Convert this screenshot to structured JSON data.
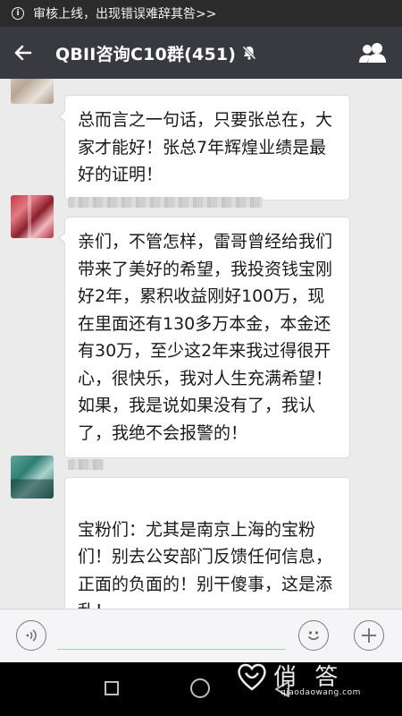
{
  "notice": {
    "text": "审核上线，出现错误难辞其咎>>"
  },
  "header": {
    "title": "QBII咨询C10群(451)"
  },
  "messages": [
    {
      "text": "总而言之一句话，只要张总在，大家才能好！张总7年辉煌业绩是最好的证明！"
    },
    {
      "text": "亲们，不管怎样，雷哥曾经给我们带来了美好的希望，我投资钱宝刚好2年，累积收益刚好100万，现在里面还有130多万本金，本金还有30万，至少这2年来我过得很开心，很快乐，我对人生充满希望！如果，我是说如果没有了，我认了，我绝不会报警的！"
    },
    {
      "text": "宝粉们：尤其是南京上海的宝粉们！别去公安部门反馈任何信息，正面的负面的！别干傻事，这是添乱！\n政府来查，那就查，钱宝七年，成"
    }
  ],
  "watermark": {
    "text": "俏 答",
    "sub": "qiaodaowang.com"
  },
  "colors": {
    "header_bg": "#393a3f",
    "notice_bg": "#2b2b2b",
    "chat_bg": "#ebebeb"
  }
}
